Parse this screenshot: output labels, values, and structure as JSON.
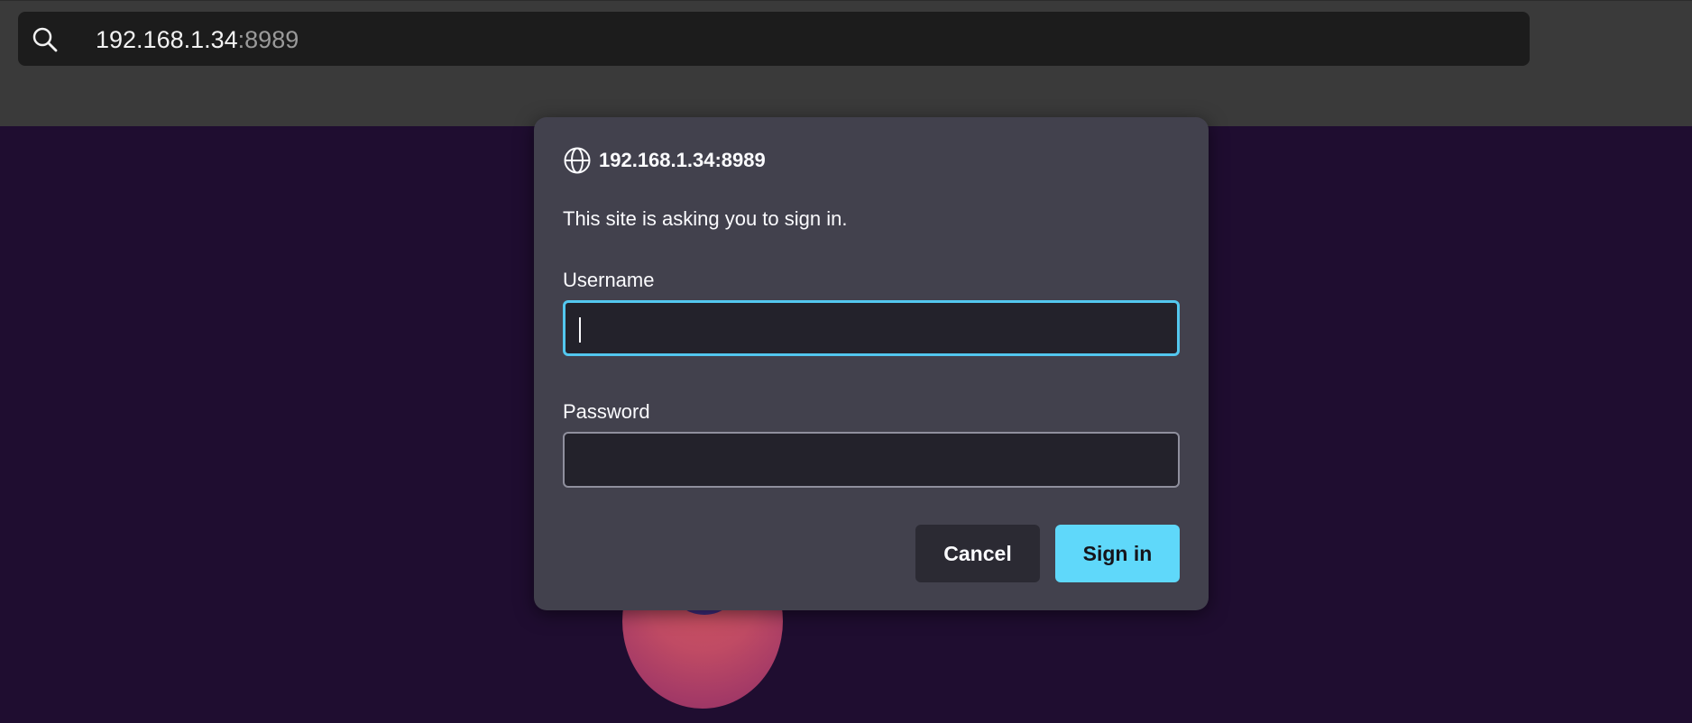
{
  "browser": {
    "url_host": "192.168.1.34",
    "url_port": ":8989",
    "search_icon": "search-icon"
  },
  "dialog": {
    "host": "192.168.1.34:8989",
    "host_icon": "globe-icon",
    "message": "This site is asking you to sign in.",
    "username_label": "Username",
    "username_value": "",
    "password_label": "Password",
    "password_value": "",
    "cancel_label": "Cancel",
    "signin_label": "Sign in"
  },
  "colors": {
    "accent": "#5fd8fa",
    "focus_ring": "#53c7ef",
    "dialog_bg": "#42414d",
    "page_bg": "#1f0d30"
  }
}
